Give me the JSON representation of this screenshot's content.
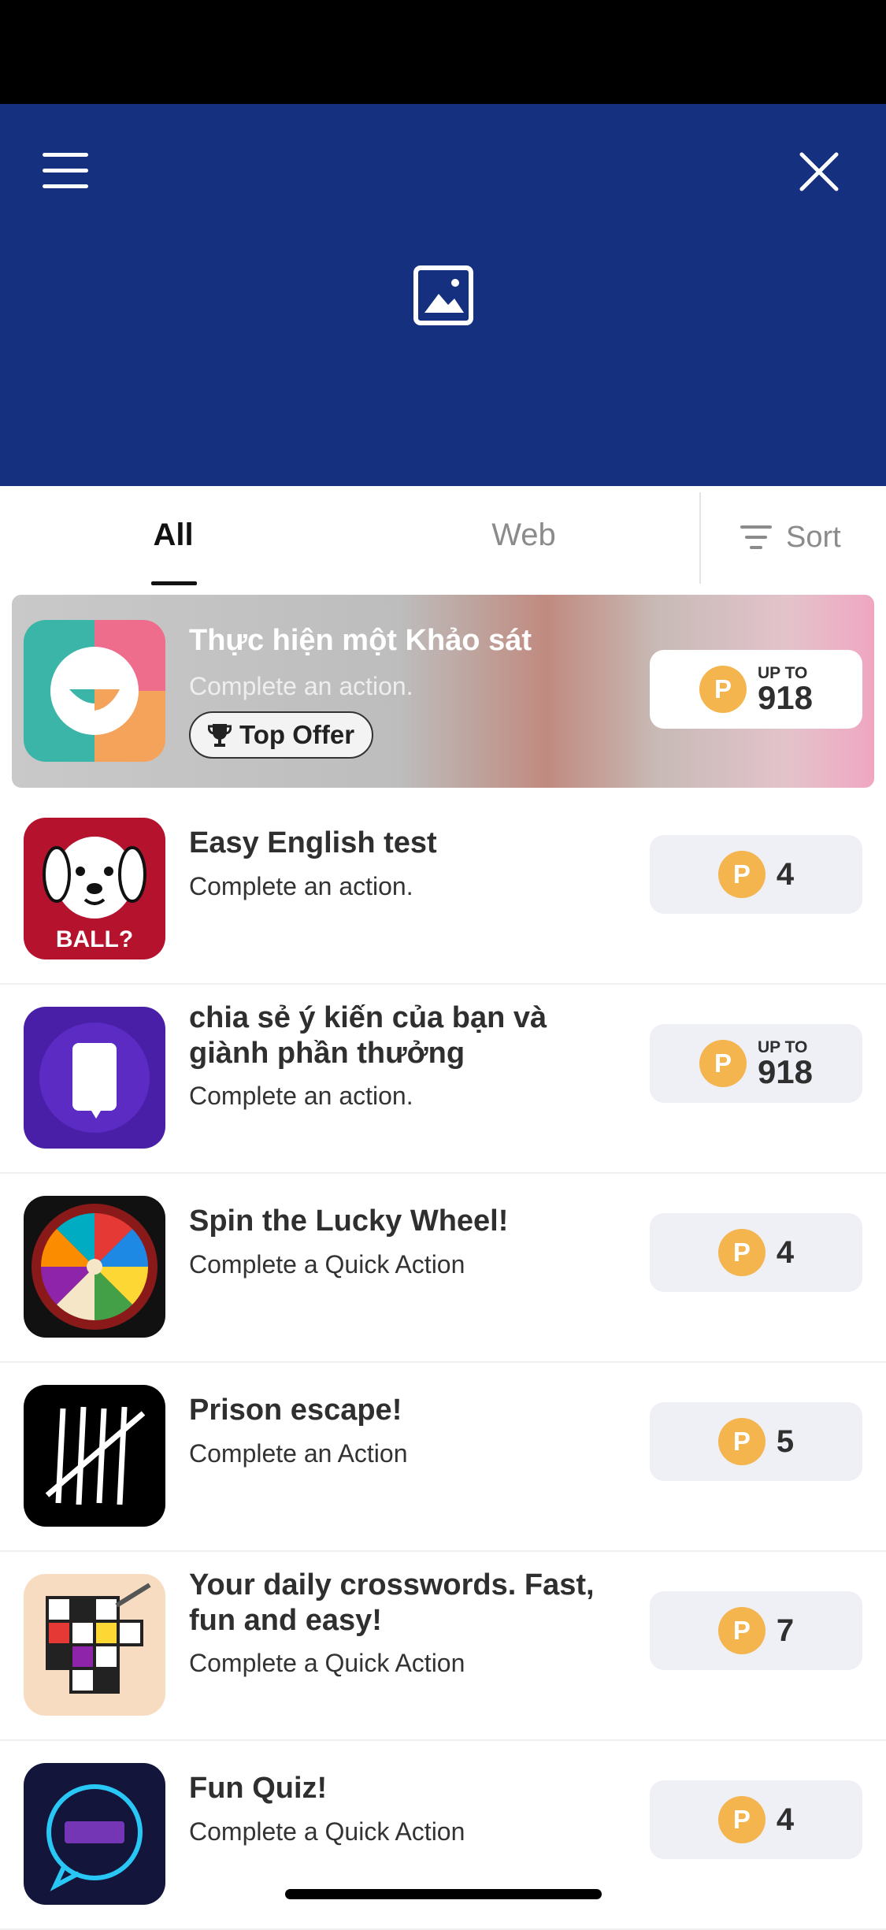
{
  "header": {
    "bg_color": "#163080",
    "menu_icon": "hamburger-menu-icon",
    "close_icon": "close-icon",
    "banner_icon": "image-placeholder-icon"
  },
  "tabs": {
    "all_label": "All",
    "web_label": "Web",
    "sort_label": "Sort"
  },
  "offers": [
    {
      "title": "Thực hiện một Khảo sát",
      "subtitle": "Complete an action.",
      "badge": "Top Offer",
      "upto": "UP TO",
      "points": "918",
      "icon": "survey-smile-icon"
    },
    {
      "title": "Easy English test",
      "subtitle": "Complete an action.",
      "points": "4",
      "icon": "dog-ball-icon"
    },
    {
      "title": "chia sẻ ý kiến của bạn và giành phần thưởng",
      "subtitle": "Complete an action.",
      "upto": "UP TO",
      "points": "918",
      "icon": "phone-chat-icon"
    },
    {
      "title": "Spin the Lucky Wheel!",
      "subtitle": "Complete a Quick Action",
      "points": "4",
      "icon": "lucky-wheel-icon"
    },
    {
      "title": "Prison escape!",
      "subtitle": "Complete an Action",
      "points": "5",
      "icon": "tally-marks-icon"
    },
    {
      "title": "Your daily crosswords. Fast, fun and easy!",
      "subtitle": "Complete a Quick Action",
      "points": "7",
      "icon": "crossword-icon"
    },
    {
      "title": "Fun Quiz!",
      "subtitle": "Complete a Quick Action",
      "points": "4",
      "icon": "quiz-bubble-icon"
    }
  ],
  "coin_label": "P",
  "colors": {
    "coin": "#f4b44e",
    "points_bg": "#eef0f6"
  }
}
